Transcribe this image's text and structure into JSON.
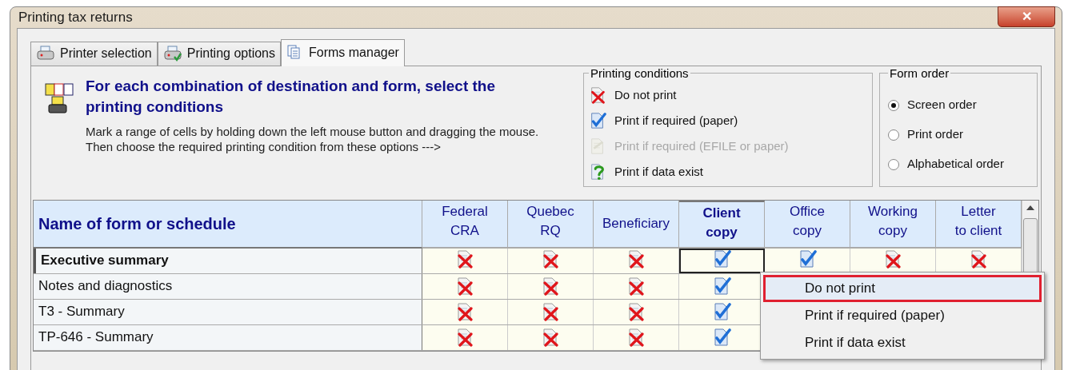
{
  "window": {
    "title": "Printing tax returns",
    "close": "✕"
  },
  "tabs": [
    {
      "label": "Printer selection",
      "kind": "printer",
      "selected": false
    },
    {
      "label": "Printing options",
      "kind": "options",
      "selected": false
    },
    {
      "label": "Forms manager",
      "kind": "forms",
      "selected": true
    }
  ],
  "instructions": {
    "heading": "For each combination of destination and form, select the printing conditions",
    "text": "Mark a range of cells by holding down the left mouse button and dragging the mouse. Then choose the required printing condition from these options --->"
  },
  "printing_conditions": {
    "title": "Printing conditions",
    "items": [
      {
        "label": "Do not print",
        "kind": "x",
        "disabled": false
      },
      {
        "label": "Print if required (paper)",
        "kind": "check",
        "disabled": false
      },
      {
        "label": "Print if required (EFILE or paper)",
        "kind": "efile",
        "disabled": true
      },
      {
        "label": "Print if data exist",
        "kind": "question",
        "disabled": false
      }
    ]
  },
  "form_order": {
    "title": "Form order",
    "options": [
      {
        "label": "Screen order",
        "selected": true
      },
      {
        "label": "Print order",
        "selected": false
      },
      {
        "label": "Alphabetical order",
        "selected": false
      }
    ]
  },
  "table": {
    "columns": [
      {
        "label": "Name of form or schedule",
        "selected": false
      },
      {
        "label": "Federal\nCRA",
        "selected": false
      },
      {
        "label": "Quebec\nRQ",
        "selected": false
      },
      {
        "label": "Beneficiary",
        "selected": false
      },
      {
        "label": "Client\ncopy",
        "selected": true
      },
      {
        "label": "Office\ncopy",
        "selected": false
      },
      {
        "label": "Working\ncopy",
        "selected": false
      },
      {
        "label": "Letter\nto client",
        "selected": false
      }
    ],
    "rows": [
      {
        "name": "Executive summary",
        "selected": true,
        "cells": [
          {
            "kind": "x",
            "focused": false
          },
          {
            "kind": "x",
            "focused": false
          },
          {
            "kind": "x",
            "focused": false
          },
          {
            "kind": "check",
            "focused": true
          },
          {
            "kind": "check",
            "focused": false
          },
          {
            "kind": "x",
            "focused": false
          },
          {
            "kind": "x",
            "focused": false
          }
        ]
      },
      {
        "name": "Notes and diagnostics",
        "selected": false,
        "cells": [
          {
            "kind": "x",
            "focused": false
          },
          {
            "kind": "x",
            "focused": false
          },
          {
            "kind": "x",
            "focused": false
          },
          {
            "kind": "check",
            "focused": false
          }
        ]
      },
      {
        "name": "T3 - Summary",
        "selected": false,
        "cells": [
          {
            "kind": "x",
            "focused": false
          },
          {
            "kind": "x",
            "focused": false
          },
          {
            "kind": "x",
            "focused": false
          },
          {
            "kind": "check",
            "focused": false
          }
        ]
      },
      {
        "name": "TP-646 - Summary",
        "selected": false,
        "cells": [
          {
            "kind": "x",
            "focused": false
          },
          {
            "kind": "x",
            "focused": false
          },
          {
            "kind": "x",
            "focused": false
          },
          {
            "kind": "check",
            "focused": false
          }
        ]
      }
    ]
  },
  "context_menu": {
    "items": [
      {
        "label": "Do not print",
        "selected": true
      },
      {
        "label": "Print if required (paper)",
        "selected": false
      },
      {
        "label": "Print if data exist",
        "selected": false
      }
    ]
  }
}
